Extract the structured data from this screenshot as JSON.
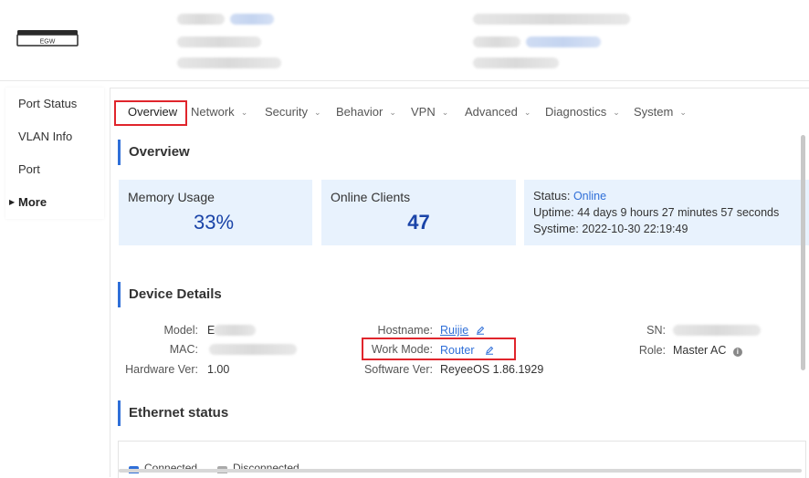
{
  "header": {
    "device_label": "EGW"
  },
  "sidebar": {
    "items": [
      {
        "label": "Port Status"
      },
      {
        "label": "VLAN Info"
      },
      {
        "label": "Port"
      },
      {
        "label": "More"
      }
    ]
  },
  "tabs": [
    {
      "label": "Overview",
      "active": true
    },
    {
      "label": "Network"
    },
    {
      "label": "Security"
    },
    {
      "label": "Behavior"
    },
    {
      "label": "VPN"
    },
    {
      "label": "Advanced"
    },
    {
      "label": "Diagnostics"
    },
    {
      "label": "System"
    }
  ],
  "overview": {
    "title": "Overview",
    "memory_label": "Memory Usage",
    "memory_value": "33%",
    "clients_label": "Online Clients",
    "clients_value": "47",
    "status_label": "Status:",
    "status_value": "Online",
    "uptime_label": "Uptime:",
    "uptime_value": "44 days 9 hours 27 minutes 57 seconds",
    "systime_label": "Systime:",
    "systime_value": "2022-10-30 22:19:49"
  },
  "device_details": {
    "title": "Device Details",
    "model_label": "Model:",
    "model_value": "E",
    "mac_label": "MAC:",
    "hw_label": "Hardware Ver:",
    "hw_value": "1.00",
    "hostname_label": "Hostname:",
    "hostname_value": "Ruijie",
    "workmode_label": "Work Mode:",
    "workmode_value": "Router",
    "sw_label": "Software Ver:",
    "sw_value": "ReyeeOS 1.86.1929",
    "sn_label": "SN:",
    "role_label": "Role:",
    "role_value": "Master AC"
  },
  "ethernet": {
    "title": "Ethernet status",
    "legend_connected": "Connected",
    "legend_disconnected": "Disconnected"
  },
  "colors": {
    "accent": "#2f6fd8",
    "highlight_box": "#e0252c",
    "card_bg": "#e8f2fd"
  }
}
